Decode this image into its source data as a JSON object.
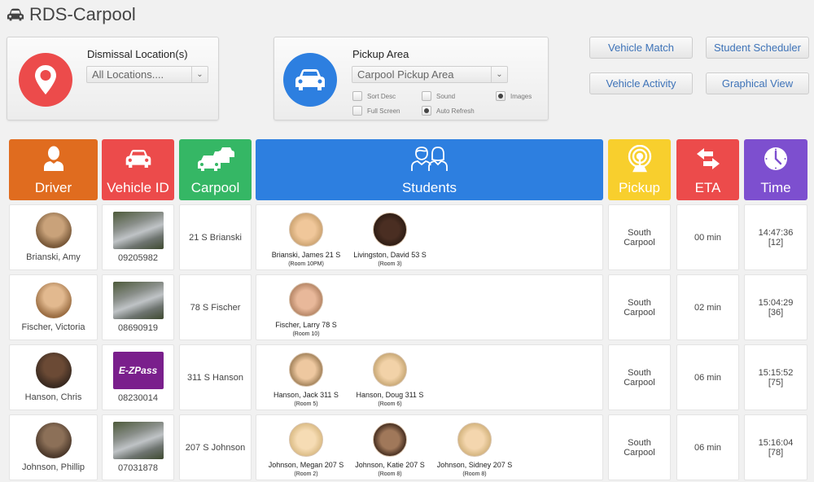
{
  "app": {
    "title": "RDS-Carpool",
    "icon": "car-icon"
  },
  "dismissal": {
    "label": "Dismissal Location(s)",
    "selected": "All Locations....",
    "icon": "location-pin-icon"
  },
  "pickup": {
    "label": "Pickup Area",
    "selected": "Carpool Pickup Area",
    "icon": "car-icon",
    "options": [
      {
        "label": "Sort Desc",
        "checked": false
      },
      {
        "label": "Sound",
        "checked": false
      },
      {
        "label": "Images",
        "checked": true
      },
      {
        "label": "Full Screen",
        "checked": false
      },
      {
        "label": "Auto Refresh",
        "checked": true
      }
    ]
  },
  "actions": {
    "vehicle_match": "Vehicle Match",
    "student_scheduler": "Student Scheduler",
    "vehicle_activity": "Vehicle Activity",
    "graphical_view": "Graphical View"
  },
  "columns": [
    {
      "label": "Driver",
      "icon": "person-icon",
      "color": "#e06c1f"
    },
    {
      "label": "Vehicle ID",
      "icon": "car-icon",
      "color": "#ec4b4b"
    },
    {
      "label": "Carpool",
      "icon": "multiple-cars-icon",
      "color": "#35b765"
    },
    {
      "label": "Students",
      "icon": "students-icon",
      "color": "#2d7fe0"
    },
    {
      "label": "Pickup",
      "icon": "broadcast-icon",
      "color": "#f8cf2d"
    },
    {
      "label": "ETA",
      "icon": "exchange-arrows-icon",
      "color": "#ec4b4b"
    },
    {
      "label": "Time",
      "icon": "clock-icon",
      "color": "#7d4fcf"
    }
  ],
  "rows": [
    {
      "driver": "Brianski, Amy",
      "vehicle_id": "09205982",
      "vehicle_image": "car-photo",
      "carpool": "21 S Brianski",
      "students": [
        {
          "name": "Brianski, James 21 S",
          "room": "(Room 10PM)"
        },
        {
          "name": "Livingston, David 53 S",
          "room": "(Room 3)"
        }
      ],
      "pickup_line1": "South",
      "pickup_line2": "Carpool",
      "eta": "00 min",
      "time": "14:47:36",
      "queue": "[12]"
    },
    {
      "driver": "Fischer, Victoria",
      "vehicle_id": "08690919",
      "vehicle_image": "car-photo",
      "carpool": "78 S Fischer",
      "students": [
        {
          "name": "Fischer, Larry 78 S",
          "room": "(Room 10)"
        }
      ],
      "pickup_line1": "South",
      "pickup_line2": "Carpool",
      "eta": "02 min",
      "time": "15:04:29",
      "queue": "[36]"
    },
    {
      "driver": "Hanson, Chris",
      "vehicle_id": "08230014",
      "vehicle_image": "ezpass-tag",
      "vehicle_tag_text": "E-ZPass",
      "carpool": "311 S Hanson",
      "students": [
        {
          "name": "Hanson, Jack 311 S",
          "room": "(Room 5)"
        },
        {
          "name": "Hanson, Doug 311 S",
          "room": "(Room 6)"
        }
      ],
      "pickup_line1": "South",
      "pickup_line2": "Carpool",
      "eta": "06 min",
      "time": "15:15:52",
      "queue": "[75]"
    },
    {
      "driver": "Johnson, Phillip",
      "vehicle_id": "07031878",
      "vehicle_image": "car-photo",
      "carpool": "207 S Johnson",
      "students": [
        {
          "name": "Johnson, Megan 207 S",
          "room": "(Room 2)"
        },
        {
          "name": "Johnson, Katie 207 S",
          "room": "(Room 8)"
        },
        {
          "name": "Johnson, Sidney 207 S",
          "room": "(Room 8)"
        }
      ],
      "pickup_line1": "South",
      "pickup_line2": "Carpool",
      "eta": "06 min",
      "time": "15:16:04",
      "queue": "[78]"
    }
  ]
}
